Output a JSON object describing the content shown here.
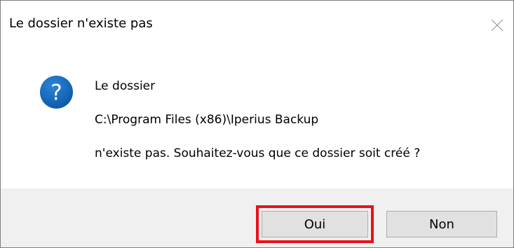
{
  "dialog": {
    "title": "Le dossier n'existe pas",
    "close_icon": "close-icon",
    "icon": "question-icon",
    "message_lines": [
      "Le dossier",
      "C:\\Program Files (x86)\\Iperius Backup",
      "n'existe pas. Souhaitez-vous que ce dossier soit créé ?"
    ],
    "buttons": {
      "yes": "Oui",
      "no": "Non"
    },
    "highlight_color": "#e8121b",
    "icon_color": "#1565c0"
  }
}
